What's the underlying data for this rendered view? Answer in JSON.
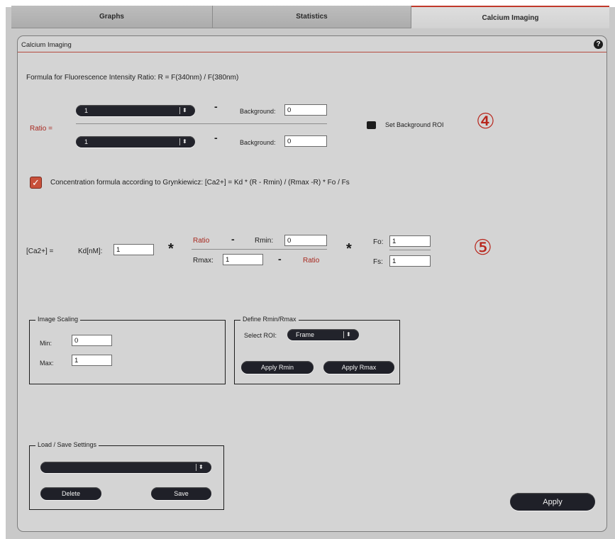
{
  "tabs": [
    {
      "label": "Graphs"
    },
    {
      "label": "Statistics"
    },
    {
      "label": "Calcium Imaging"
    }
  ],
  "panel": {
    "title": "Calcium Imaging",
    "help": "?"
  },
  "ratio_section": {
    "formula_text": "Formula for Fluorescence Intensity Ratio: R = F(340nm) / F(380nm)",
    "ratio_label": "Ratio =",
    "channel1_value": "1",
    "channel2_value": "1",
    "minus": "-",
    "background_label": "Background:",
    "background1_value": "0",
    "background2_value": "0",
    "set_background_roi_label": "Set Background ROI",
    "step_marker": "④"
  },
  "concentration": {
    "checkbox_checked": true,
    "checkmark": "✓",
    "formula_text": "Concentration formula according to Grynkiewicz: [Ca2+] = Kd * (R - Rmin) / (Rmax -R) * Fo / Fs"
  },
  "grynkiewicz": {
    "ca_label": "[Ca2+] =",
    "kd_label": "Kd[nM]:",
    "kd_value": "1",
    "multiply": "*",
    "ratio_label": "Ratio",
    "minus": "-",
    "rmin_label": "Rmin:",
    "rmin_value": "0",
    "rmax_label": "Rmax:",
    "rmax_value": "1",
    "fo_label": "Fo:",
    "fo_value": "1",
    "fs_label": "Fs:",
    "fs_value": "1",
    "step_marker": "⑤"
  },
  "image_scaling": {
    "legend": "Image Scaling",
    "min_label": "Min:",
    "min_value": "0",
    "max_label": "Max:",
    "max_value": "1"
  },
  "define_rmin_rmax": {
    "legend": "Define Rmin/Rmax",
    "select_roi_label": "Select ROI:",
    "select_roi_value": "Frame",
    "apply_rmin_label": "Apply Rmin",
    "apply_rmax_label": "Apply Rmax"
  },
  "load_save": {
    "legend": "Load / Save Settings",
    "settings_value": "",
    "delete_label": "Delete",
    "save_label": "Save"
  },
  "apply_label": "Apply",
  "dropdown_arrow": "⬍",
  "colors": {
    "accent_red": "#a8281f",
    "panel_bg": "#d4d4d4",
    "pill_dark": "#22232b"
  }
}
